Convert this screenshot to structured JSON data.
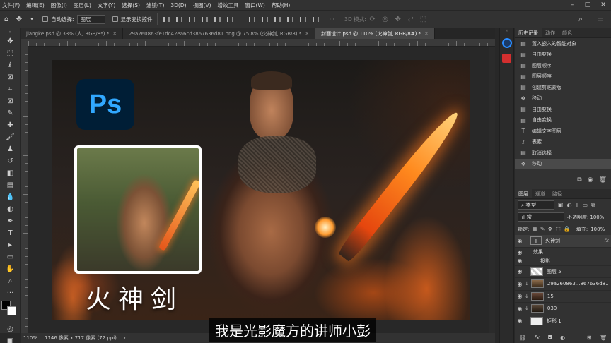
{
  "menu": [
    "文件(F)",
    "编辑(E)",
    "图像(I)",
    "图层(L)",
    "文字(Y)",
    "选择(S)",
    "滤镜(T)",
    "3D(D)",
    "视图(V)",
    "增效工具",
    "窗口(W)",
    "帮助(H)"
  ],
  "options": {
    "auto_select_label": "自动选择:",
    "auto_select_value": "图层",
    "show_transform_label": "显示变换控件",
    "mode_3d": "3D 模式:",
    "more": "···"
  },
  "tabs": [
    {
      "label": "jiangke.psd @ 33% (人, RGB/8*) *"
    },
    {
      "label": "29a260863fe1dc42ea6cd3867636d81.png @ 75.8% (火神剑, RGB/8) *"
    },
    {
      "label": "封面设计.psd @ 110% (火神剑, RGB/8#) *"
    }
  ],
  "artwork": {
    "ps_logo": "Ps",
    "title": "火神剑"
  },
  "status": {
    "zoom": "110%",
    "size": "1146 像素 x 717 像素 (72 ppi)"
  },
  "subtitle": "我是光影魔方的讲师小彭",
  "right_panel": {
    "tabs": [
      "历史记录",
      "动作",
      "颜色"
    ],
    "history": [
      "置入嵌入的智能对象",
      "自由变换",
      "图层顺序",
      "图层顺序",
      "创建剪贴蒙版",
      "移动",
      "自由变换",
      "自由变换",
      "编辑文字图层",
      "表索",
      "取消选择",
      "移动"
    ],
    "layers_tabs": [
      "图层",
      "通道",
      "路径"
    ],
    "filter": "类型",
    "blend": "正常",
    "opacity_label": "不透明度:",
    "opacity": "100%",
    "lock_label": "锁定:",
    "fill_label": "填充:",
    "fill": "100%",
    "layers": [
      {
        "name": "火神剑"
      },
      {
        "name": "效果"
      },
      {
        "name": "投影"
      },
      {
        "name": "图层 5"
      },
      {
        "name": "29a260863...867636d81"
      },
      {
        "name": "15"
      },
      {
        "name": "030"
      },
      {
        "name": "矩形 1"
      }
    ],
    "fx": "fx"
  }
}
